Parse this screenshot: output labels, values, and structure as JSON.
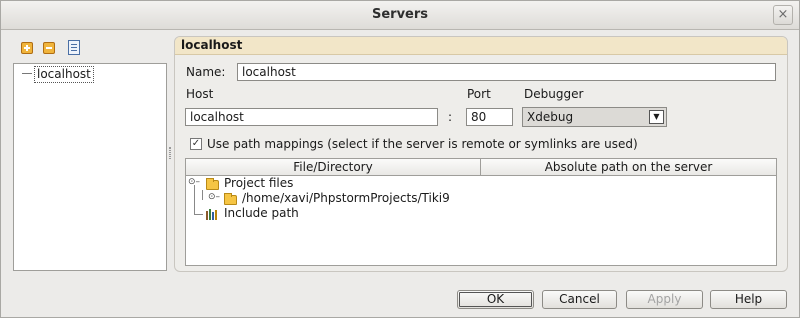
{
  "window": {
    "title": "Servers",
    "close_symbol": "×"
  },
  "toolbar": {
    "add_icon": "add-server-icon",
    "remove_icon": "remove-server-icon",
    "copy_icon": "copy-server-icon"
  },
  "server_list": {
    "items": [
      "localhost"
    ]
  },
  "panel": {
    "header": "localhost",
    "name_label": "Name:",
    "name_value": "localhost",
    "host_label": "Host",
    "host_value": "localhost",
    "colon": ":",
    "port_label": "Port",
    "port_value": "80",
    "debugger_label": "Debugger",
    "debugger_value": "Xdebug",
    "path_mappings_label": "Use path mappings (select if the server is remote or symlinks are used)",
    "path_mappings_checked": true
  },
  "table": {
    "columns": [
      "File/Directory",
      "Absolute path on the server"
    ],
    "rows": [
      "Project files",
      "/home/xavi/PhpstormProjects/Tiki9",
      "Include path"
    ]
  },
  "buttons": {
    "ok": "OK",
    "cancel": "Cancel",
    "apply": "Apply",
    "help": "Help"
  }
}
